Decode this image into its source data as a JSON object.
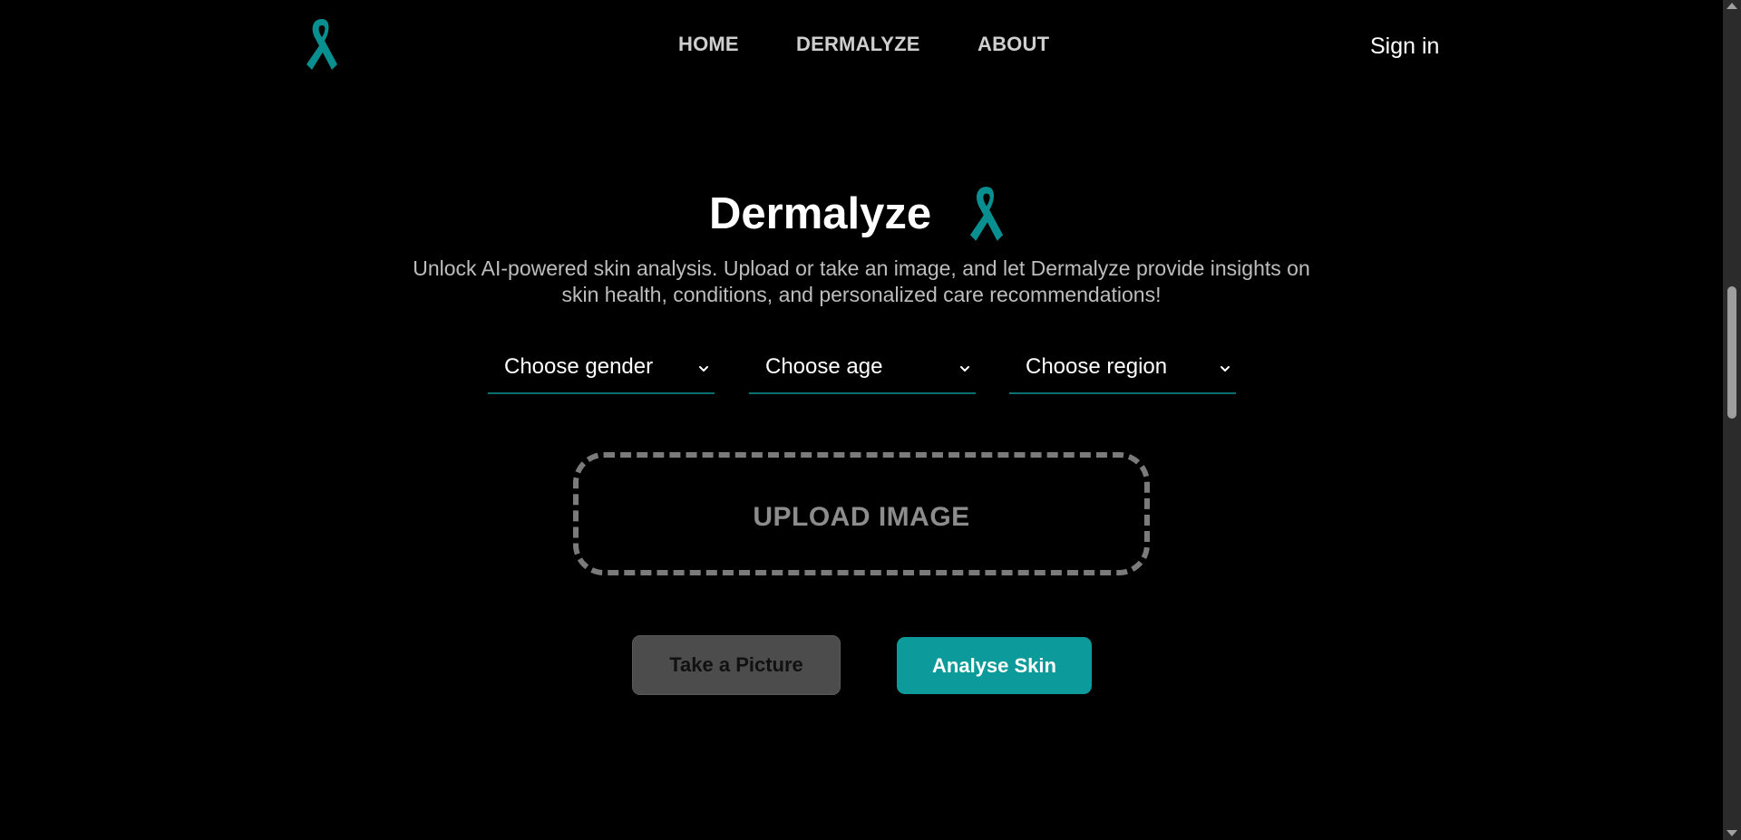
{
  "colors": {
    "background": "#000000",
    "accent": "#0d9a9a",
    "ribbon": "#0a8f90",
    "select_underline": "#0b6f70"
  },
  "nav": {
    "logo_icon": "awareness-ribbon-icon",
    "links": [
      {
        "label": "HOME"
      },
      {
        "label": "DERMALYZE"
      },
      {
        "label": "ABOUT"
      }
    ],
    "sign_in": "Sign in"
  },
  "hero": {
    "title": "Dermalyze",
    "title_icon": "awareness-ribbon-icon",
    "description": "Unlock AI-powered skin analysis. Upload or take an image, and let Dermalyze provide insights on skin health, conditions, and personalized care recommendations!"
  },
  "selects": [
    {
      "label": "Choose gender",
      "icon": "chevron-down-icon"
    },
    {
      "label": "Choose age",
      "icon": "chevron-down-icon"
    },
    {
      "label": "Choose region",
      "icon": "chevron-down-icon"
    }
  ],
  "upload": {
    "label": "UPLOAD IMAGE"
  },
  "buttons": {
    "take_picture": "Take a Picture",
    "analyse": "Analyse Skin"
  }
}
